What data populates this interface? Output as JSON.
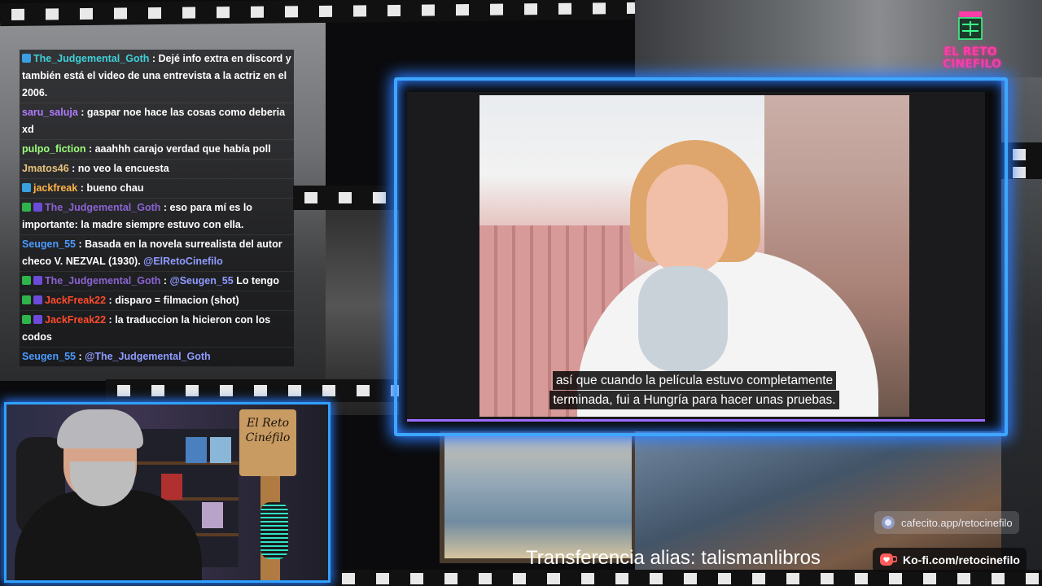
{
  "logo": {
    "text": "EL RETO\nCINEFILO"
  },
  "chat": {
    "messages": [
      {
        "badges": [
          "prime"
        ],
        "user": "The_Judgemental_Goth",
        "color": "#3fd0d8",
        "text": "Dejé info extra en discord y también está el video de una entrevista a la actriz en el 2006."
      },
      {
        "badges": [],
        "user": "saru_saluja",
        "color": "#b07cff",
        "text": "gaspar noe hace las cosas como deberia xd"
      },
      {
        "badges": [],
        "user": "pulpo_fiction",
        "color": "#9cff7a",
        "text": "aaahhh carajo verdad que había poll"
      },
      {
        "badges": [],
        "user": "Jmatos46",
        "color": "#e8c27a",
        "text": "no veo la encuesta"
      },
      {
        "badges": [
          "prime"
        ],
        "user": "jackfreak",
        "color": "#ffb347",
        "text": "bueno chau"
      },
      {
        "badges": [
          "mod",
          "sub"
        ],
        "user": "The_Judgemental_Goth",
        "color": "#8a63d2",
        "text": "eso para mí es lo importante: la madre siempre estuvo con ella."
      },
      {
        "badges": [],
        "user": "Seugen_55",
        "color": "#4a9bff",
        "text": "Basada en la novela surrealista del autor checo V. NEZVAL (1930).",
        "mention": "@ElRetoCinefilo"
      },
      {
        "badges": [
          "mod",
          "sub"
        ],
        "user": "The_Judgemental_Goth",
        "color": "#8a63d2",
        "mention_first": "@Seugen_55",
        "text": "Lo tengo"
      },
      {
        "badges": [
          "mod",
          "sub"
        ],
        "user": "JackFreak22",
        "color": "#ff4b2b",
        "text": "disparo = filmacion (shot)"
      },
      {
        "badges": [
          "mod",
          "sub"
        ],
        "user": "JackFreak22",
        "color": "#ff4b2b",
        "text": "la traduccion la hicieron con los codos"
      },
      {
        "badges": [],
        "user": "Seugen_55",
        "color": "#4a9bff",
        "mention_first": "@The_Judgemental_Goth",
        "text": ""
      }
    ]
  },
  "video": {
    "subtitle_line1": "así que cuando la película estuvo completamente",
    "subtitle_line2": "terminada, fui a Hungría para hacer unas pruebas."
  },
  "webcam": {
    "sign_text": "El Reto\nCinéfilo"
  },
  "footer": {
    "transfer": "Transferencia alias: talismanlibros",
    "cafecito": "cafecito.app/retocinefilo",
    "kofi": "Ko-fi.com/retocinefilo"
  },
  "colors": {
    "frame_glow": "#3ea6ff",
    "logo_pink": "#ff3da8",
    "mention": "#8f9bff"
  }
}
